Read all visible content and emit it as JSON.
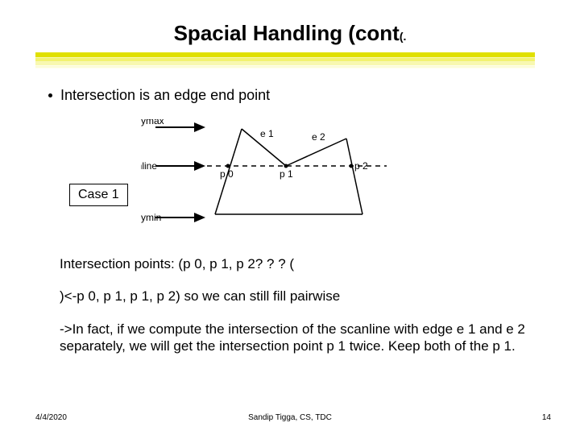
{
  "title": {
    "main": "Spacial Handling (cont",
    "suffix": "(."
  },
  "bullet": "Intersection is an edge end point",
  "case_label": "Case 1",
  "diagram": {
    "ymax": "ymax",
    "ymin": "ymin",
    "scanline": "scanline",
    "e1": "e 1",
    "e2": "e 2",
    "p0": "p 0",
    "p1": "p 1",
    "p2": "p 2"
  },
  "paragraphs": {
    "line1": "Intersection points: (p 0, p 1, p 2? ? ? (",
    "line2": ")<-p 0, p 1, p 1, p 2) so we can still fill pairwise",
    "line3": "->In fact, if we compute the intersection of the scanline with edge e 1 and e 2 separately, we will get the intersection point p 1 twice. Keep both of the p 1."
  },
  "footer": {
    "date": "4/4/2020",
    "author": "Sandip Tigga, CS, TDC",
    "page": "14"
  }
}
